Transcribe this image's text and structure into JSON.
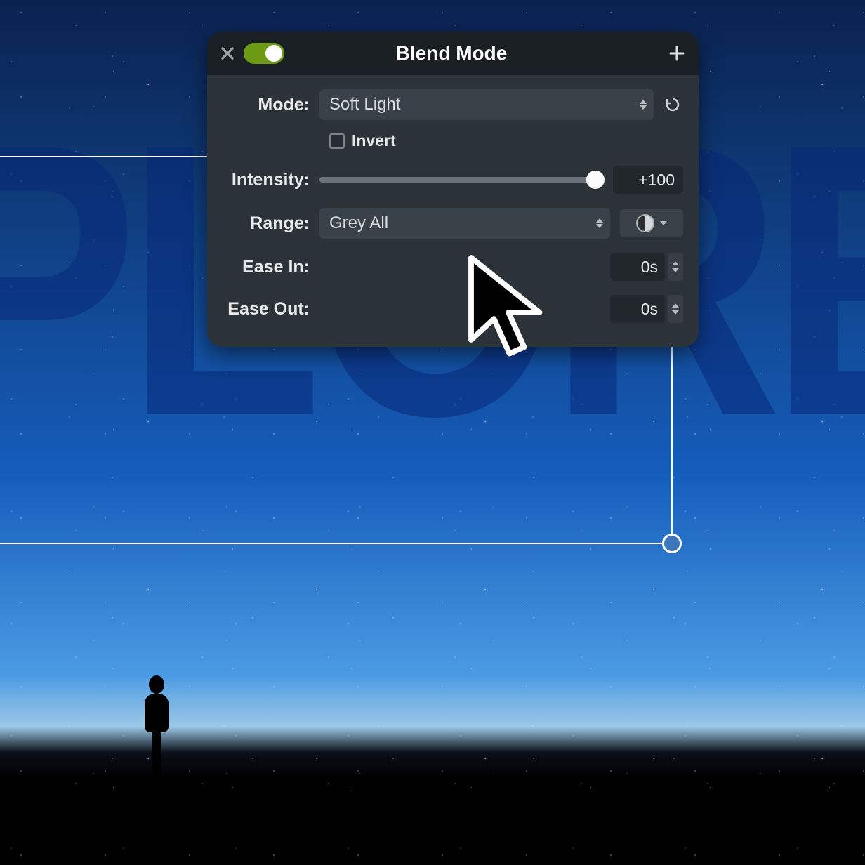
{
  "background_text": "PLORE",
  "panel": {
    "title": "Blend Mode",
    "toggle_on": true,
    "mode": {
      "label": "Mode:",
      "value": "Soft Light"
    },
    "invert": {
      "label": "Invert",
      "checked": false
    },
    "intensity": {
      "label": "Intensity:",
      "value": "+100"
    },
    "range": {
      "label": "Range:",
      "value": "Grey All"
    },
    "ease_in": {
      "label": "Ease In:",
      "value": "0s"
    },
    "ease_out": {
      "label": "Ease Out:",
      "value": "0s"
    }
  }
}
